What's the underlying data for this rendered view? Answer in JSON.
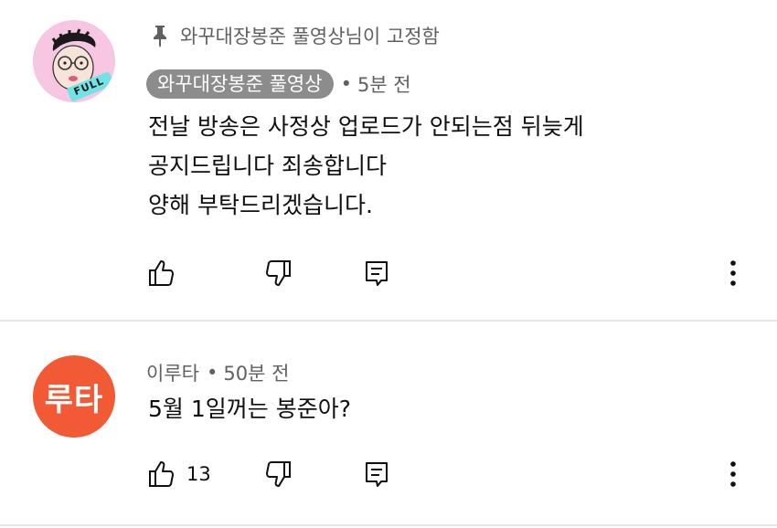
{
  "pinned": {
    "label": "와꾸대장봉준 풀영상님이 고정함"
  },
  "comments": [
    {
      "author": "와꾸대장봉준 풀영상",
      "time": "5분 전",
      "text": "전날 방송은 사정상 업로드가 안되는점 뒤늦게\n공지드립니다 죄송합니다\n양해 부탁드리겠습니다.",
      "avatar_badge": "FULL",
      "like_count": ""
    },
    {
      "author": "이루타",
      "time": "50분 전",
      "text": "5월 1일꺼는 봉준아?",
      "avatar_text": "루타",
      "like_count": "13"
    }
  ],
  "separator": "•",
  "icons": {
    "pin": "pin-icon",
    "like": "thumbs-up-icon",
    "dislike": "thumbs-down-icon",
    "reply": "reply-icon",
    "more": "more-vert-icon"
  },
  "colors": {
    "author_chip_bg": "#8c8c8c",
    "avatar2_bg": "#f25a35",
    "avatar1_bg": "#f7c6e2"
  }
}
